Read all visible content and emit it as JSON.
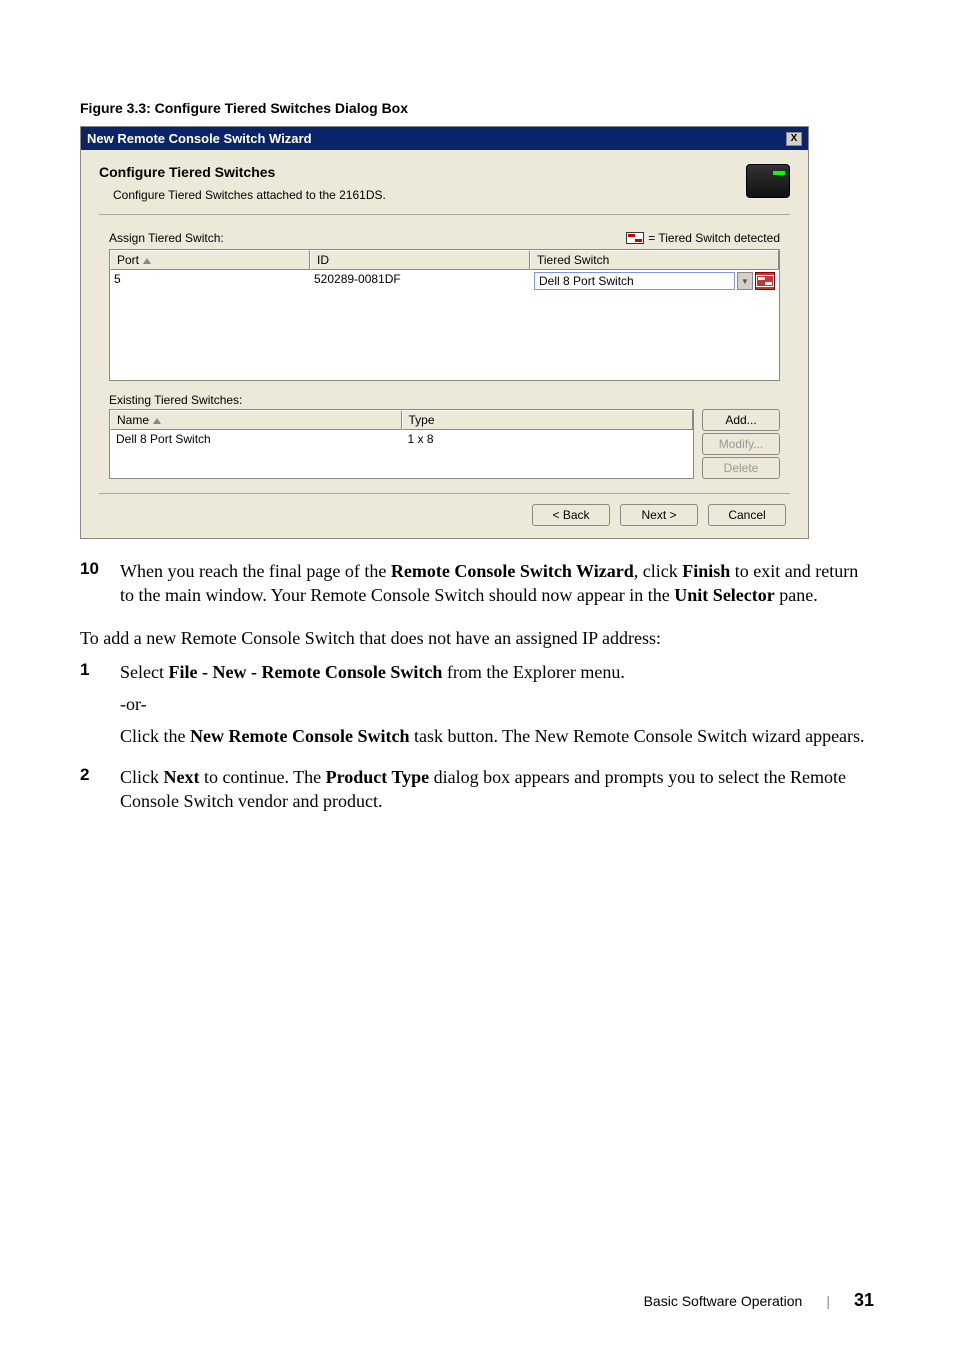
{
  "figureCaption": "Figure 3.3: Configure Tiered Switches Dialog Box",
  "dialog": {
    "title": "New Remote Console Switch Wizard",
    "close": "X",
    "header": {
      "title": "Configure Tiered Switches",
      "subtitle": "Configure Tiered Switches attached to the 2161DS."
    },
    "assign": {
      "label": "Assign Tiered Switch:",
      "legend": "= Tiered Switch detected",
      "cols": {
        "port": "Port",
        "id": "ID",
        "ts": "Tiered Switch"
      },
      "row": {
        "port": "5",
        "id": "520289-0081DF",
        "ts": "Dell 8 Port Switch"
      }
    },
    "existing": {
      "label": "Existing Tiered Switches:",
      "cols": {
        "name": "Name",
        "type": "Type"
      },
      "row": {
        "name": "Dell 8 Port Switch",
        "type": "1 x 8"
      },
      "add": "Add...",
      "modify": "Modify...",
      "delete": "Delete"
    },
    "buttons": {
      "back": "< Back",
      "next": "Next >",
      "cancel": "Cancel"
    }
  },
  "body": {
    "step10": {
      "num": "10",
      "text_a": "When you reach the final page of the ",
      "bold_a": "Remote Console Switch Wizard",
      "text_b": ", click ",
      "bold_b": "Finish",
      "text_c": " to exit and return to the main window. Your Remote Console Switch should now appear in the ",
      "bold_c": "Unit Selector",
      "text_d": " pane."
    },
    "intro": "To add a new Remote Console Switch that does not have an assigned IP address:",
    "step1": {
      "num": "1",
      "text_a": "Select ",
      "bold_a": "File - New - Remote Console Switch",
      "text_b": " from the Explorer menu.",
      "or": "-or-",
      "text_c": "Click the ",
      "bold_c": "New Remote Console Switch",
      "text_d": " task button. The New Remote Console Switch wizard appears."
    },
    "step2": {
      "num": "2",
      "text_a": "Click ",
      "bold_a": "Next",
      "text_b": " to continue. The ",
      "bold_b": "Product Type",
      "text_c": " dialog box appears and prompts you to select the Remote Console Switch vendor and product."
    }
  },
  "footer": {
    "section": "Basic Software Operation",
    "page": "31"
  }
}
